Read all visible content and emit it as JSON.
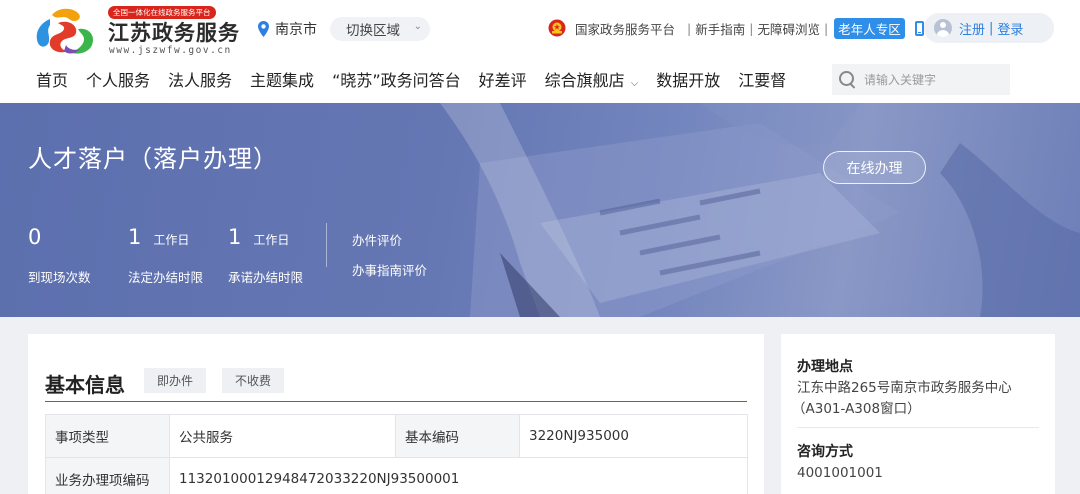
{
  "header": {
    "logo": {
      "tagline": "全国一体化在线政务服务平台",
      "title": "江苏政务服务",
      "url": "www.jszwfw.gov.cn"
    },
    "city": "南京市",
    "switch_area": "切换区域",
    "top_links": {
      "national": "国家政务服务平台",
      "guide": "新手指南",
      "accessible": "无障碍浏览",
      "elder": "老年人专区"
    },
    "login": {
      "register": "注册",
      "login": "登录"
    },
    "nav": [
      "首页",
      "个人服务",
      "法人服务",
      "主题集成",
      "“晓苏”政务问答台",
      "好差评",
      "综合旗舰店",
      "数据开放",
      "江要督"
    ],
    "search": {
      "placeholder": "请输入关键字"
    }
  },
  "banner": {
    "title": "人才落户（落户办理）",
    "online_button": "在线办理",
    "stats": [
      {
        "value": "0",
        "unit": "",
        "label": "到现场次数"
      },
      {
        "value": "1",
        "unit": "工作日",
        "label": "法定办结时限"
      },
      {
        "value": "1",
        "unit": "工作日",
        "label": "承诺办结时限"
      }
    ],
    "eval_links": [
      "办件评价",
      "办事指南评价"
    ]
  },
  "basic_info": {
    "title": "基本信息",
    "tags": [
      "即办件",
      "不收费"
    ],
    "rows": [
      {
        "k1": "事项类型",
        "v1": "公共服务",
        "k2": "基本编码",
        "v2": "3220NJ935000"
      },
      {
        "k1": "业务办理项编码",
        "v1": "11320100012948472033220NJ93500001"
      }
    ]
  },
  "side": {
    "location_label": "办理地点",
    "location_line1": "江东中路265号南京市政务服务中心",
    "location_line2": "（A301-A308窗口）",
    "consult_label": "咨询方式",
    "consult_value": "4001001001"
  },
  "colors": {
    "brand_red": "#d9261c",
    "link_blue": "#2f7fe0",
    "banner_blue": "#6577b3"
  }
}
